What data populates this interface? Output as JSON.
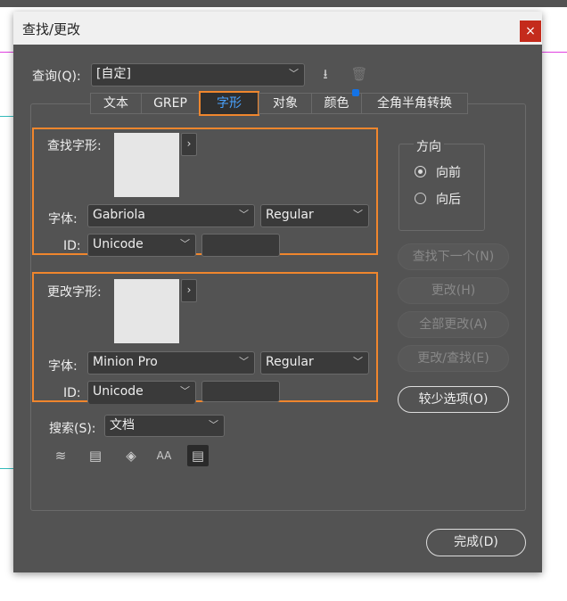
{
  "dialog": {
    "title": "查找/更改",
    "close": "×"
  },
  "query": {
    "label": "查询(Q):",
    "value": "[自定]"
  },
  "tabs": [
    "文本",
    "GREP",
    "字形",
    "对象",
    "颜色",
    "全角半角转换"
  ],
  "find": {
    "label": "查找字形:",
    "font_label": "字体:",
    "font": "Gabriola",
    "style": "Regular",
    "id_label": "ID:",
    "id_type": "Unicode",
    "id_value": ""
  },
  "change": {
    "label": "更改字形:",
    "font_label": "字体:",
    "font": "Minion Pro",
    "style": "Regular",
    "id_label": "ID:",
    "id_type": "Unicode",
    "id_value": ""
  },
  "direction": {
    "title": "方向",
    "forward": "向前",
    "backward": "向后"
  },
  "buttons": {
    "find_next": "查找下一个(N)",
    "change": "更改(H)",
    "change_all": "全部更改(A)",
    "change_find": "更改/查找(E)",
    "fewer": "较少选项(O)",
    "done": "完成(D)"
  },
  "search": {
    "label": "搜索(S):",
    "value": "文档"
  },
  "colors": {
    "accent": "#f0862d",
    "active_tab_text": "#4aa3ff",
    "badge": "#1473e6"
  }
}
